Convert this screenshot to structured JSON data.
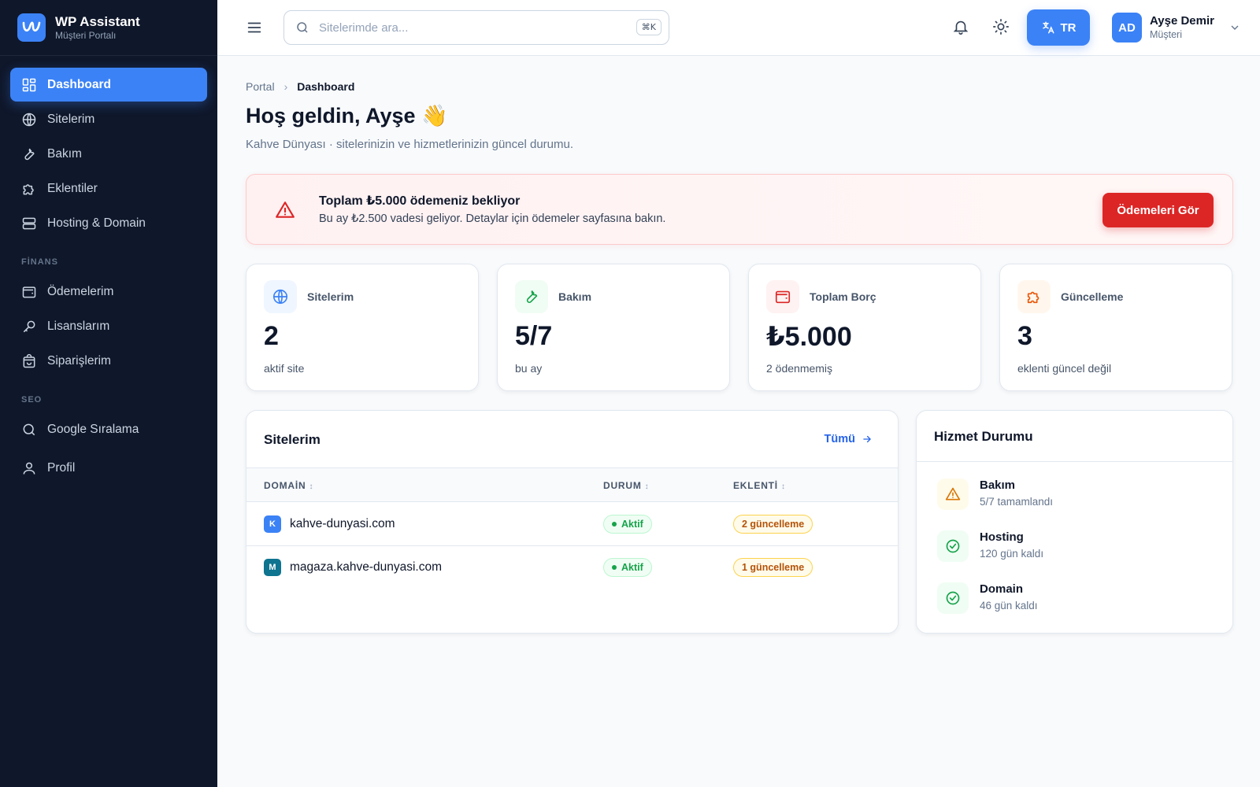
{
  "brand": {
    "title": "WP Assistant",
    "subtitle": "Müşteri Portalı"
  },
  "sidebar": {
    "main_items": [
      {
        "label": "Dashboard",
        "icon": "grid-icon",
        "active": true
      },
      {
        "label": "Sitelerim",
        "icon": "globe-icon"
      },
      {
        "label": "Bakım",
        "icon": "wrench-icon"
      },
      {
        "label": "Eklentiler",
        "icon": "puzzle-icon"
      },
      {
        "label": "Hosting & Domain",
        "icon": "server-icon"
      }
    ],
    "finance_section": "FİNANS",
    "finance_items": [
      {
        "label": "Ödemelerim",
        "icon": "wallet-icon"
      },
      {
        "label": "Lisanslarım",
        "icon": "key-icon"
      },
      {
        "label": "Siparişlerim",
        "icon": "bag-icon"
      }
    ],
    "seo_section": "SEO",
    "seo_items": [
      {
        "label": "Google Sıralama",
        "icon": "search-icon"
      },
      {
        "label": "Profil",
        "icon": "user-icon"
      }
    ]
  },
  "header": {
    "search_placeholder": "Sitelerimde ara...",
    "search_shortcut": "⌘K",
    "lang": "TR",
    "user_initials": "AD",
    "user_name": "Ayşe Demir",
    "user_role": "Müşteri"
  },
  "breadcrumb": {
    "root": "Portal",
    "current": "Dashboard"
  },
  "page": {
    "title": "Hoş geldin, Ayşe 👋",
    "subtitle": "Kahve Dünyası · sitelerinizin ve hizmetlerinizin güncel durumu."
  },
  "alert": {
    "title": "Toplam ₺5.000 ödemeniz bekliyor",
    "text": "Bu ay ₺2.500 vadesi geliyor. Detaylar için ödemeler sayfasına bakın.",
    "button": "Ödemeleri Gör"
  },
  "stats": [
    {
      "label": "Sitelerim",
      "value": "2",
      "sub": "aktif site",
      "icon": "globe-icon",
      "color": "#3b82f6",
      "bg": "#eff6ff"
    },
    {
      "label": "Bakım",
      "value": "5/7",
      "sub": "bu ay",
      "icon": "wrench-icon",
      "color": "#16a34a",
      "bg": "#f0fdf4"
    },
    {
      "label": "Toplam Borç",
      "value": "₺5.000",
      "sub": "2 ödenmemiş",
      "icon": "wallet-icon",
      "color": "#dc2626",
      "bg": "#fef2f2"
    },
    {
      "label": "Güncelleme",
      "value": "3",
      "sub": "eklenti güncel değil",
      "icon": "puzzle-icon",
      "color": "#ea580c",
      "bg": "#fff7ed"
    }
  ],
  "sites": {
    "title": "Sitelerim",
    "see_all": "Tümü",
    "columns": [
      "DOMAİN",
      "DURUM",
      "EKLENTİ"
    ],
    "rows": [
      {
        "initial": "K",
        "badge_color": "#3b82f6",
        "domain": "kahve-dunyasi.com",
        "status": "Aktif",
        "plugins": "2 güncelleme"
      },
      {
        "initial": "M",
        "badge_color": "#0e7490",
        "domain": "magaza.kahve-dunyasi.com",
        "status": "Aktif",
        "plugins": "1 güncelleme"
      }
    ]
  },
  "services": {
    "title": "Hizmet Durumu",
    "items": [
      {
        "title": "Bakım",
        "sub": "5/7 tamamlandı",
        "icon": "warning-icon",
        "color": "#d97706",
        "bg": "#fffbeb"
      },
      {
        "title": "Hosting",
        "sub": "120 gün kaldı",
        "icon": "check-circle-icon",
        "color": "#16a34a",
        "bg": "#f0fdf4"
      },
      {
        "title": "Domain",
        "sub": "46 gün kaldı",
        "icon": "check-circle-icon",
        "color": "#16a34a",
        "bg": "#f0fdf4"
      }
    ]
  }
}
